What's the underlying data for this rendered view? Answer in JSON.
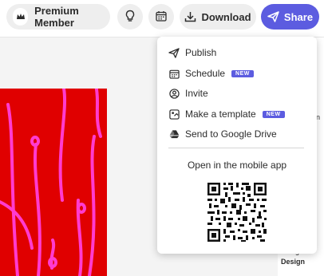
{
  "toolbar": {
    "premium_label": "Premium Member",
    "download_label": "Download",
    "share_label": "Share",
    "accent_color": "#5c5ce0"
  },
  "menu": {
    "items": [
      {
        "label": "Publish",
        "icon": "send-icon",
        "badge": ""
      },
      {
        "label": "Schedule",
        "icon": "calendar-icon",
        "badge": "NEW"
      },
      {
        "label": "Invite",
        "icon": "invite-icon",
        "badge": ""
      },
      {
        "label": "Make a template",
        "icon": "template-icon",
        "badge": "NEW"
      },
      {
        "label": "Send to Google Drive",
        "icon": "google-drive-icon",
        "badge": ""
      }
    ],
    "mobile_title": "Open in the mobile app"
  },
  "right_panel": {
    "design_label": "Design",
    "fragment_1": "n",
    "fragment_2": "g"
  },
  "canvas": {
    "artboard_color": "#e00000",
    "pattern_color": "#ff3bd0"
  }
}
